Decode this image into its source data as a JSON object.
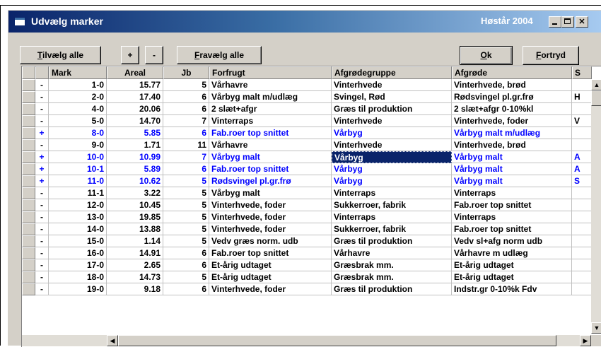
{
  "window": {
    "title": "Udvælg marker",
    "season": "Høstår 2004"
  },
  "toolbar": {
    "select_all": {
      "pre": "",
      "accel": "T",
      "post": "ilvælg alle"
    },
    "plus": "+",
    "minus": "-",
    "deselect_all": {
      "pre": "",
      "accel": "F",
      "post": "ravælg alle"
    },
    "ok": {
      "pre": "",
      "accel": "O",
      "post": "k"
    },
    "cancel": {
      "pre": "",
      "accel": "F",
      "post": "ortryd"
    }
  },
  "grid": {
    "columns": [
      "",
      "Mark",
      "Areal",
      "Jb",
      "Forfrugt",
      "Afgrødegruppe",
      "Afgrøde",
      "S"
    ],
    "rows": [
      {
        "mark": "-",
        "field": "1-0",
        "area": "15.77",
        "jb": "5",
        "prev": "Vårhavre",
        "group": "Vinterhvede",
        "crop": "Vinterhvede, brød",
        "s": "",
        "sel": false
      },
      {
        "mark": "-",
        "field": "2-0",
        "area": "17.40",
        "jb": "6",
        "prev": "Vårbyg malt m/udlæg",
        "group": "Svingel, Rød",
        "crop": "Rødsvingel pl.gr.frø",
        "s": "H",
        "sel": false
      },
      {
        "mark": "-",
        "field": "4-0",
        "area": "20.06",
        "jb": "6",
        "prev": "2 slæt+afgr",
        "group": "Græs til produktion",
        "crop": "2 slæt+afgr 0-10%kl",
        "s": "",
        "sel": false
      },
      {
        "mark": "-",
        "field": "5-0",
        "area": "14.70",
        "jb": "7",
        "prev": "Vinterraps",
        "group": "Vinterhvede",
        "crop": "Vinterhvede, foder",
        "s": "V",
        "sel": false
      },
      {
        "mark": "+",
        "field": "8-0",
        "area": "5.85",
        "jb": "6",
        "prev": "Fab.roer top snittet",
        "group": "Vårbyg",
        "crop": "Vårbyg malt m/udlæg",
        "s": "",
        "sel": true
      },
      {
        "mark": "-",
        "field": "9-0",
        "area": "1.71",
        "jb": "11",
        "prev": "Vårhavre",
        "group": "Vinterhvede",
        "crop": "Vinterhvede, brød",
        "s": "",
        "sel": false
      },
      {
        "mark": "+",
        "field": "10-0",
        "area": "10.99",
        "jb": "7",
        "prev": "Vårbyg malt",
        "group": "Vårbyg",
        "crop": "Vårbyg malt",
        "s": "A",
        "sel": true,
        "focus": true
      },
      {
        "mark": "+",
        "field": "10-1",
        "area": "5.89",
        "jb": "6",
        "prev": "Fab.roer top snittet",
        "group": "Vårbyg",
        "crop": "Vårbyg malt",
        "s": "A",
        "sel": true
      },
      {
        "mark": "+",
        "field": "11-0",
        "area": "10.62",
        "jb": "5",
        "prev": "Rødsvingel pl.gr.frø",
        "group": "Vårbyg",
        "crop": "Vårbyg malt",
        "s": "S",
        "sel": true
      },
      {
        "mark": "-",
        "field": "11-1",
        "area": "3.22",
        "jb": "5",
        "prev": "Vårbyg malt",
        "group": "Vinterraps",
        "crop": "Vinterraps",
        "s": "",
        "sel": false
      },
      {
        "mark": "-",
        "field": "12-0",
        "area": "10.45",
        "jb": "5",
        "prev": "Vinterhvede, foder",
        "group": "Sukkerroer, fabrik",
        "crop": "Fab.roer top snittet",
        "s": "",
        "sel": false
      },
      {
        "mark": "-",
        "field": "13-0",
        "area": "19.85",
        "jb": "5",
        "prev": "Vinterhvede, foder",
        "group": "Vinterraps",
        "crop": "Vinterraps",
        "s": "",
        "sel": false
      },
      {
        "mark": "-",
        "field": "14-0",
        "area": "13.88",
        "jb": "5",
        "prev": "Vinterhvede, foder",
        "group": "Sukkerroer, fabrik",
        "crop": "Fab.roer top snittet",
        "s": "",
        "sel": false
      },
      {
        "mark": "-",
        "field": "15-0",
        "area": "1.14",
        "jb": "5",
        "prev": "Vedv græs norm. udb",
        "group": "Græs til produktion",
        "crop": "Vedv sl+afg norm udb",
        "s": "",
        "sel": false
      },
      {
        "mark": "-",
        "field": "16-0",
        "area": "14.91",
        "jb": "6",
        "prev": "Fab.roer top snittet",
        "group": "Vårhavre",
        "crop": "Vårhavre m udlæg",
        "s": "",
        "sel": false
      },
      {
        "mark": "-",
        "field": "17-0",
        "area": "2.65",
        "jb": "6",
        "prev": "Et-årig udtaget",
        "group": "Græsbrak mm.",
        "crop": "Et-årig udtaget",
        "s": "",
        "sel": false
      },
      {
        "mark": "-",
        "field": "18-0",
        "area": "14.73",
        "jb": "5",
        "prev": "Et-årig udtaget",
        "group": "Græsbrak mm.",
        "crop": "Et-årig udtaget",
        "s": "",
        "sel": false
      },
      {
        "mark": "-",
        "field": "19-0",
        "area": "9.18",
        "jb": "6",
        "prev": "Vinterhvede, foder",
        "group": "Græs til produktion",
        "crop": "Indstr.gr 0-10%k Fdv",
        "s": "",
        "sel": false
      }
    ]
  },
  "colors": {
    "selected_text": "#0000ff",
    "titlebar": "#0a246a",
    "focus_cell": "#0a246a"
  }
}
